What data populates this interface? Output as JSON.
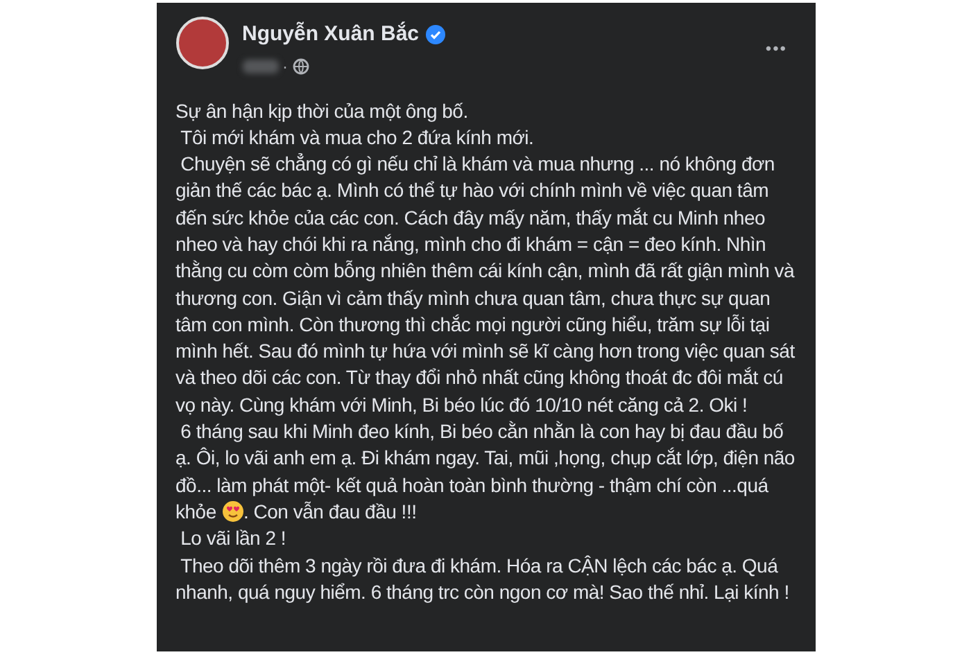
{
  "post": {
    "author": {
      "name": "Nguyễn Xuân Bắc",
      "verified": true
    },
    "meta": {
      "separator": "·"
    },
    "menu": "•••",
    "paragraphs": [
      {
        "parts": [
          {
            "kind": "text",
            "text": "Sự ân hận kịp thời của một ông bố."
          }
        ]
      },
      {
        "parts": [
          {
            "kind": "text",
            "text": " Tôi mới khám và mua cho 2 đứa kính mới."
          }
        ]
      },
      {
        "parts": [
          {
            "kind": "text",
            "text": " Chuyện sẽ chẳng có gì nếu chỉ là khám và mua nhưng ... nó không đơn giản thế các bác ạ. Mình có thể tự hào với chính mình về việc quan tâm đến sức khỏe của các con. Cách đây mấy năm, thấy mắt cu Minh nheo nheo và hay chói khi ra nắng, mình cho đi khám = cận = đeo kính. Nhìn thằng cu còm còm bỗng nhiên thêm cái kính cận, mình đã rất giận mình và thương con. Giận vì cảm thấy mình chưa quan tâm, chưa thực sự quan tâm con mình. Còn thương thì chắc mọi người cũng hiểu, trăm sự lỗi tại mình hết. Sau đó mình tự hứa với mình sẽ kĩ càng hơn trong việc quan sát và theo dõi các con. Từ thay đổi nhỏ nhất cũng không thoát đc đôi mắt cú vọ này. Cùng khám với Minh, Bi béo lúc đó 10/10 nét căng cả 2. Oki !"
          }
        ]
      },
      {
        "parts": [
          {
            "kind": "text",
            "text": " 6 tháng sau khi Minh đeo kính, Bi béo cằn nhằn là con hay bị đau đầu bố ạ. Ôi, lo vãi anh em ạ. Đi khám ngay. Tai, mũi ,họng, chụp cắt lớp, điện não đồ... làm phát một- kết quả hoàn toàn bình thường - thậm chí còn ...quá khỏe "
          },
          {
            "kind": "emoji"
          },
          {
            "kind": "text",
            "text": ". Con vẫn đau đầu !!!"
          }
        ]
      },
      {
        "parts": [
          {
            "kind": "text",
            "text": " Lo vãi lần 2 !"
          }
        ]
      },
      {
        "parts": [
          {
            "kind": "text",
            "text": " Theo dõi thêm 3 ngày rồi đưa đi khám. Hóa ra CẬN lệch các bác ạ. Quá nhanh, quá nguy hiểm. 6 tháng trc còn ngon cơ mà! Sao thế nhỉ. Lại kính !"
          }
        ]
      }
    ]
  }
}
